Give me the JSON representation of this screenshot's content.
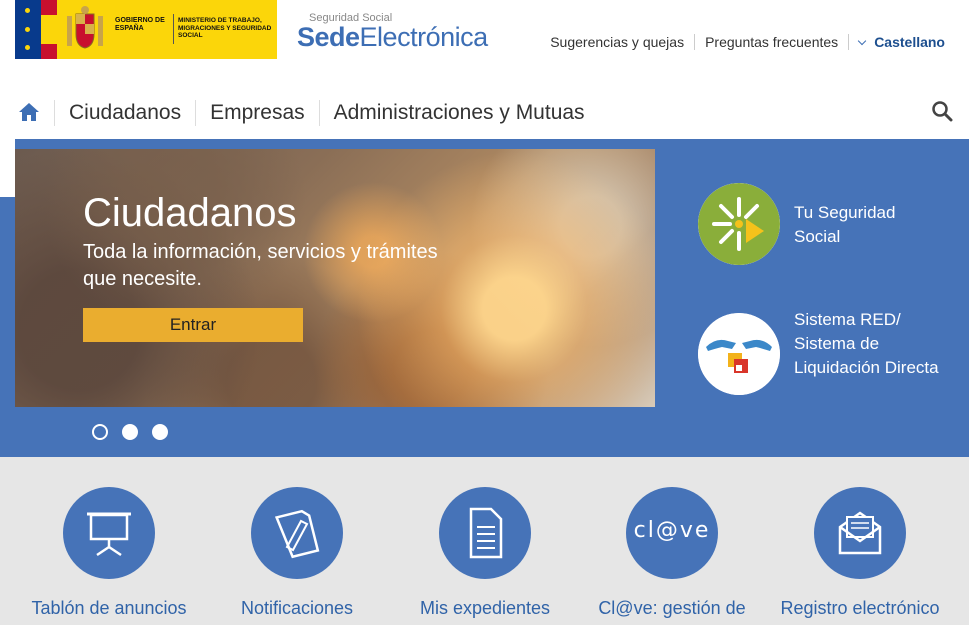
{
  "header": {
    "gov_text": "GOBIERNO DE ESPAÑA",
    "ministry_text": "MINISTERIO DE TRABAJO, MIGRACIONES Y SEGURIDAD SOCIAL",
    "sede_sub": "Seguridad Social",
    "sede_bold": "Sede",
    "sede_rest": "Electrónica",
    "links": {
      "suggestions": "Sugerencias y quejas",
      "faq": "Preguntas frecuentes",
      "language": "Castellano"
    }
  },
  "nav": {
    "items": [
      "Ciudadanos",
      "Empresas",
      "Administraciones y Mutuas"
    ]
  },
  "hero": {
    "title": "Ciudadanos",
    "text": "Toda la información, servicios y trámites que necesite.",
    "button": "Entrar",
    "slide_count": 3,
    "active_slide": 1
  },
  "side_links": [
    {
      "label": "Tu Seguridad Social",
      "icon": "tu-seguridad-social-logo"
    },
    {
      "label": "Sistema RED/ Sistema de Liquidación Directa",
      "icon": "sistema-red-logo"
    }
  ],
  "services": [
    {
      "label": "Tablón de anuncios",
      "icon": "presentation-board-icon"
    },
    {
      "label": "Notificaciones",
      "icon": "notification-document-icon"
    },
    {
      "label": "Mis expedientes",
      "icon": "document-icon"
    },
    {
      "label": "Cl@ve: gestión de",
      "icon": "clave-logo-icon",
      "icon_text": "cl@ve"
    },
    {
      "label": "Registro electrónico",
      "icon": "envelope-icon"
    }
  ],
  "colors": {
    "brand_blue": "#4673b8",
    "gov_yellow": "#fbd60a",
    "button_yellow": "#eaad2f",
    "link_blue": "#3063a8"
  }
}
